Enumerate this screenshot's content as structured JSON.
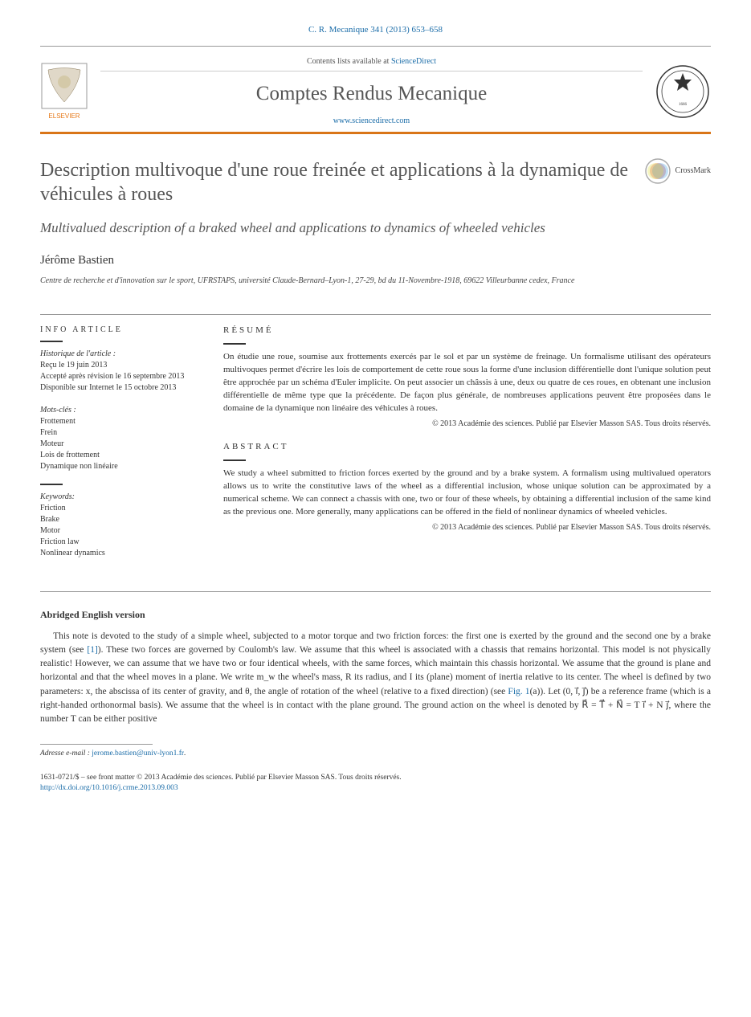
{
  "citation": "C. R. Mecanique 341 (2013) 653–658",
  "header": {
    "contents_prefix": "Contents lists available at ",
    "contents_link": "ScienceDirect",
    "journal": "Comptes Rendus Mecanique",
    "url": "www.sciencedirect.com",
    "publisher_label": "ELSEVIER"
  },
  "crossmark_label": "CrossMark",
  "title": "Description multivoque d'une roue freinée et applications à la dynamique de véhicules à roues",
  "subtitle": "Multivalued description of a braked wheel and applications to dynamics of wheeled vehicles",
  "authors": "Jérôme Bastien",
  "affiliation": "Centre de recherche et d'innovation sur le sport, UFRSTAPS, université Claude-Bernard–Lyon-1, 27-29, bd du 11-Novembre-1918, 69622 Villeurbanne cedex, France",
  "side": {
    "info_heading": "INFO ARTICLE",
    "history_label": "Historique de l'article :",
    "history_items": [
      "Reçu le 19 juin 2013",
      "Accepté après révision le 16 septembre 2013",
      "Disponible sur Internet le 15 octobre 2013"
    ],
    "mots_label": "Mots-clés :",
    "mots_items": [
      "Frottement",
      "Frein",
      "Moteur",
      "Lois de frottement",
      "Dynamique non linéaire"
    ],
    "kw_label": "Keywords:",
    "kw_items": [
      "Friction",
      "Brake",
      "Motor",
      "Friction law",
      "Nonlinear dynamics"
    ]
  },
  "resume_heading": "RÉSUMÉ",
  "resume_text": "On étudie une roue, soumise aux frottements exercés par le sol et par un système de freinage. Un formalisme utilisant des opérateurs multivoques permet d'écrire les lois de comportement de cette roue sous la forme d'une inclusion différentielle dont l'unique solution peut être approchée par un schéma d'Euler implicite. On peut associer un châssis à une, deux ou quatre de ces roues, en obtenant une inclusion différentielle de même type que la précédente. De façon plus générale, de nombreuses applications peuvent être proposées dans le domaine de la dynamique non linéaire des véhicules à roues.",
  "abstract_heading": "ABSTRACT",
  "abstract_text": "We study a wheel submitted to friction forces exerted by the ground and by a brake system. A formalism using multivalued operators allows us to write the constitutive laws of the wheel as a differential inclusion, whose unique solution can be approximated by a numerical scheme. We can connect a chassis with one, two or four of these wheels, by obtaining a differential inclusion of the same kind as the previous one. More generally, many applications can be offered in the field of nonlinear dynamics of wheeled vehicles.",
  "copyright": "© 2013 Académie des sciences. Publié par Elsevier Masson SAS. Tous droits réservés.",
  "section_head": "Abridged English version",
  "body_pre": "This note is devoted to the study of a simple wheel, subjected to a motor torque and two friction forces: the first one is exerted by the ground and the second one by a brake system (see ",
  "body_ref1": "[1]",
  "body_mid1": "). These two forces are governed by Coulomb's law. We assume that this wheel is associated with a chassis that remains horizontal. This model is not physically realistic! However, we can assume that we have two or four identical wheels, with the same forces, which maintain this chassis horizontal. We assume that the ground is plane and horizontal and that the wheel moves in a plane. We write m_w the wheel's mass, R its radius, and I its (plane) moment of inertia relative to its center. The wheel is defined by two parameters: x, the abscissa of its center of gravity, and θ, the angle of rotation of the wheel (relative to a fixed direction) (see ",
  "body_figref": "Fig. 1",
  "body_mid2": "(a)). Let (0, i⃗, j⃗) be a reference frame (which is a right-handed orthonormal basis). We assume that the wheel is in contact with the plane ground. The ground action on the wheel is denoted by R⃗ = T⃗ + N⃗ = T i⃗ + N j⃗, where the number T can be either positive",
  "footnote": {
    "label": "Adresse e-mail : ",
    "email": "jerome.bastien@univ-lyon1.fr"
  },
  "bottom": {
    "issn_line": "1631-0721/$ – see front matter © 2013 Académie des sciences. Publié par Elsevier Masson SAS. Tous droits réservés.",
    "doi": "http://dx.doi.org/10.1016/j.crme.2013.09.003"
  }
}
